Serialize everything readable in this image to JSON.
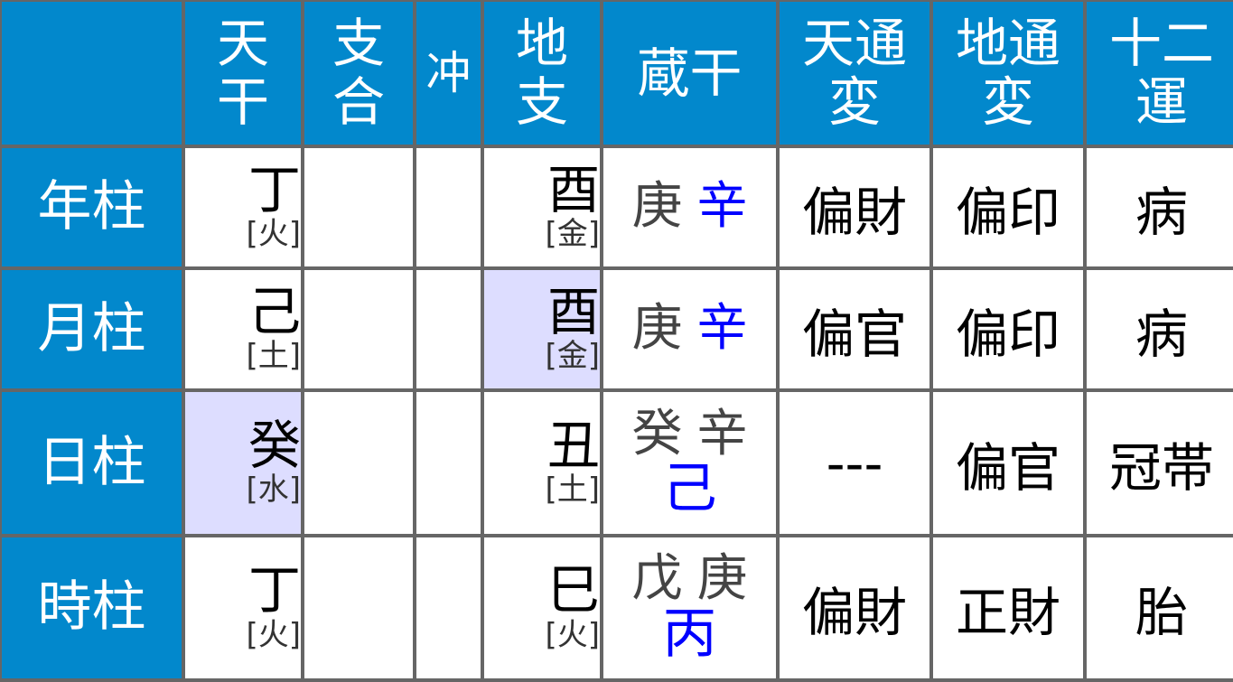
{
  "colors": {
    "header_bg": "#0288cc",
    "header_text": "#ffffff",
    "grid": "#666666",
    "highlight_bg": "#ddddff",
    "main_qi": "#0000ff",
    "sub_qi": "#444444"
  },
  "headers": {
    "corner": "",
    "tenkan": [
      "天",
      "干"
    ],
    "shigo": [
      "支",
      "合"
    ],
    "chu": "冲",
    "chishi": [
      "地",
      "支"
    ],
    "zokan": "蔵干",
    "tentsuhen": [
      "天通",
      "変"
    ],
    "chitsuhen": [
      "地通",
      "変"
    ],
    "juniun": [
      "十二",
      "運"
    ]
  },
  "rows": [
    {
      "label": "年柱",
      "tenkan": {
        "char": "丁",
        "element": "[火]",
        "highlight": false
      },
      "shigo": "",
      "chu": "",
      "chishi": {
        "char": "酉",
        "element": "[金]",
        "highlight": false
      },
      "zokan": {
        "sub": [
          "庚"
        ],
        "main": "辛",
        "layout": "inline"
      },
      "tentsuhen": "偏財",
      "chitsuhen": "偏印",
      "juniun": "病"
    },
    {
      "label": "月柱",
      "tenkan": {
        "char": "己",
        "element": "[土]",
        "highlight": false
      },
      "shigo": "",
      "chu": "",
      "chishi": {
        "char": "酉",
        "element": "[金]",
        "highlight": true
      },
      "zokan": {
        "sub": [
          "庚"
        ],
        "main": "辛",
        "layout": "inline"
      },
      "tentsuhen": "偏官",
      "chitsuhen": "偏印",
      "juniun": "病"
    },
    {
      "label": "日柱",
      "tenkan": {
        "char": "癸",
        "element": "[水]",
        "highlight": true
      },
      "shigo": "",
      "chu": "",
      "chishi": {
        "char": "丑",
        "element": "[土]",
        "highlight": false
      },
      "zokan": {
        "sub": [
          "癸",
          "辛"
        ],
        "main": "己",
        "layout": "stacked"
      },
      "tentsuhen": "---",
      "chitsuhen": "偏官",
      "juniun": "冠帯"
    },
    {
      "label": "時柱",
      "tenkan": {
        "char": "丁",
        "element": "[火]",
        "highlight": false
      },
      "shigo": "",
      "chu": "",
      "chishi": {
        "char": "巳",
        "element": "[火]",
        "highlight": false
      },
      "zokan": {
        "sub": [
          "戊",
          "庚"
        ],
        "main": "丙",
        "layout": "stacked"
      },
      "tentsuhen": "偏財",
      "chitsuhen": "正財",
      "juniun": "胎"
    }
  ]
}
